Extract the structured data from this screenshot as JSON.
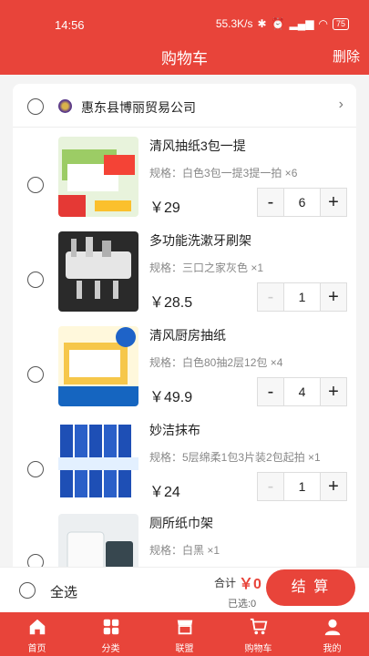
{
  "status_bar": {
    "time": "14:56",
    "net_speed": "55.3K/s",
    "battery": "75"
  },
  "header": {
    "title": "购物车",
    "delete_label": "删除"
  },
  "shop": {
    "name": "惠东县博丽贸易公司"
  },
  "items": [
    {
      "name": "清风抽纸3包一提",
      "spec": "规格：白色3包一提3提一拍 ×6",
      "price": "￥29",
      "qty": "6",
      "minus_disabled": false
    },
    {
      "name": "多功能洗漱牙刷架",
      "spec": "规格：三口之家灰色 ×1",
      "price": "￥28.5",
      "qty": "1",
      "minus_disabled": true
    },
    {
      "name": "清风厨房抽纸",
      "spec": "规格：白色80抽2层12包 ×4",
      "price": "￥49.9",
      "qty": "4",
      "minus_disabled": false
    },
    {
      "name": "妙洁抹布",
      "spec": "规格：5层绵柔1包3片装2包起拍 ×1",
      "price": "￥24",
      "qty": "1",
      "minus_disabled": true
    },
    {
      "name": "厕所纸巾架",
      "spec": "规格：白黑 ×1",
      "price": "",
      "qty": "",
      "minus_disabled": true
    }
  ],
  "stepper": {
    "minus": "-",
    "plus": "+"
  },
  "footer": {
    "select_all": "全选",
    "total_label": "合计",
    "total_value": "￥0",
    "selected_count": "已选:0",
    "checkout_label": "结 算"
  },
  "tabs": [
    {
      "label": "首页",
      "icon": "home-icon"
    },
    {
      "label": "分类",
      "icon": "category-icon"
    },
    {
      "label": "联盟",
      "icon": "store-icon"
    },
    {
      "label": "购物车",
      "icon": "cart-icon"
    },
    {
      "label": "我的",
      "icon": "user-icon"
    }
  ],
  "colors": {
    "accent": "#e8443a"
  }
}
